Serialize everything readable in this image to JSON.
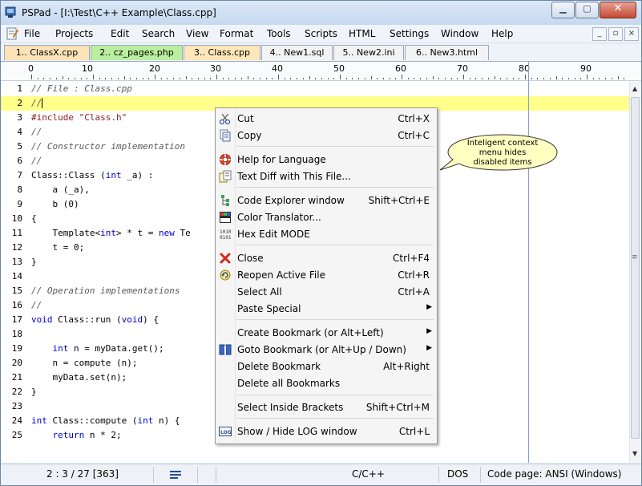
{
  "window": {
    "title": "PSPad - [I:\\Test\\C++ Example\\Class.cpp]"
  },
  "menubar": [
    "File",
    "Projects",
    "Edit",
    "Search",
    "View",
    "Format",
    "Tools",
    "Scripts",
    "HTML",
    "Settings",
    "Window",
    "Help"
  ],
  "tabs": [
    {
      "label": "1.. ClassX.cpp",
      "color": "#fde3b8"
    },
    {
      "label": "2.. cz_pages.php",
      "color": "#b9ef9e"
    },
    {
      "label": "3.. Class.cpp",
      "color": "#ffe7b9"
    },
    {
      "label": "4.. New1.sql",
      "color": "#f3f3f3"
    },
    {
      "label": "5.. New2.ini",
      "color": "#f3f3f3"
    },
    {
      "label": "6.. New3.html",
      "color": "#f3f3f3"
    }
  ],
  "ruler": [
    "0",
    "10",
    "20",
    "30",
    "40",
    "50",
    "60",
    "70",
    "80",
    "90"
  ],
  "lines": [
    {
      "n": "1",
      "t": "// File : Class.cpp"
    },
    {
      "n": "2",
      "t": "//"
    },
    {
      "n": "3",
      "t": "#include \"Class.h\""
    },
    {
      "n": "4",
      "t": "//"
    },
    {
      "n": "5",
      "t": "// Constructor implementation"
    },
    {
      "n": "6",
      "t": "//"
    },
    {
      "n": "7",
      "t": "Class::Class (int _a) :"
    },
    {
      "n": "8",
      "t": "    a (_a),"
    },
    {
      "n": "9",
      "t": "    b (0)"
    },
    {
      "n": "10",
      "t": "{"
    },
    {
      "n": "11",
      "t": "    Template<int> * t = new Te"
    },
    {
      "n": "12",
      "t": "    t = 0;"
    },
    {
      "n": "13",
      "t": "}"
    },
    {
      "n": "14",
      "t": ""
    },
    {
      "n": "15",
      "t": "// Operation implementations"
    },
    {
      "n": "16",
      "t": "//"
    },
    {
      "n": "17",
      "t": "void Class::run (void) {"
    },
    {
      "n": "18",
      "t": ""
    },
    {
      "n": "19",
      "t": "    int n = myData.get();"
    },
    {
      "n": "20",
      "t": "    n = compute (n);"
    },
    {
      "n": "21",
      "t": "    myData.set(n);"
    },
    {
      "n": "22",
      "t": "}"
    },
    {
      "n": "23",
      "t": ""
    },
    {
      "n": "24",
      "t": "int Class::compute (int n) {"
    },
    {
      "n": "25",
      "t": "    return n * 2;"
    }
  ],
  "context_menu": {
    "cut": {
      "label": "Cut",
      "shortcut": "Ctrl+X"
    },
    "copy": {
      "label": "Copy",
      "shortcut": "Ctrl+C"
    },
    "help_language": {
      "label": "Help for Language"
    },
    "text_diff": {
      "label": "Text Diff with This File..."
    },
    "code_explorer": {
      "label": "Code Explorer window",
      "shortcut": "Shift+Ctrl+E"
    },
    "color_translator": {
      "label": "Color Translator..."
    },
    "hex_edit": {
      "label": "Hex Edit MODE"
    },
    "close": {
      "label": "Close",
      "shortcut": "Ctrl+F4"
    },
    "reopen": {
      "label": "Reopen Active File",
      "shortcut": "Ctrl+R"
    },
    "select_all": {
      "label": "Select All",
      "shortcut": "Ctrl+A"
    },
    "paste_special": {
      "label": "Paste Special"
    },
    "create_bookmark": {
      "label": "Create Bookmark (or Alt+Left)"
    },
    "goto_bookmark": {
      "label": "Goto Bookmark   (or Alt+Up / Down)"
    },
    "delete_bookmark": {
      "label": "Delete Bookmark",
      "shortcut": "Alt+Right"
    },
    "delete_all_bookmarks": {
      "label": "Delete all Bookmarks"
    },
    "select_brackets": {
      "label": "Select Inside Brackets",
      "shortcut": "Shift+Ctrl+M"
    },
    "log_window": {
      "label": "Show / Hide LOG window",
      "shortcut": "Ctrl+L"
    }
  },
  "callout": {
    "line1": "Inteligent context",
    "line2": "menu hides",
    "line3": "disabled items"
  },
  "status": {
    "position": "2 : 3 / 27  [363]",
    "syntax": "C/C++",
    "line_end": "DOS",
    "codepage": "Code page: ANSI (Windows)"
  },
  "colors": {
    "current_line": "#ffff8a",
    "keyword": "#0000cc",
    "preprocessor": "#8b1a1a",
    "comment": "#5a5a5a"
  }
}
